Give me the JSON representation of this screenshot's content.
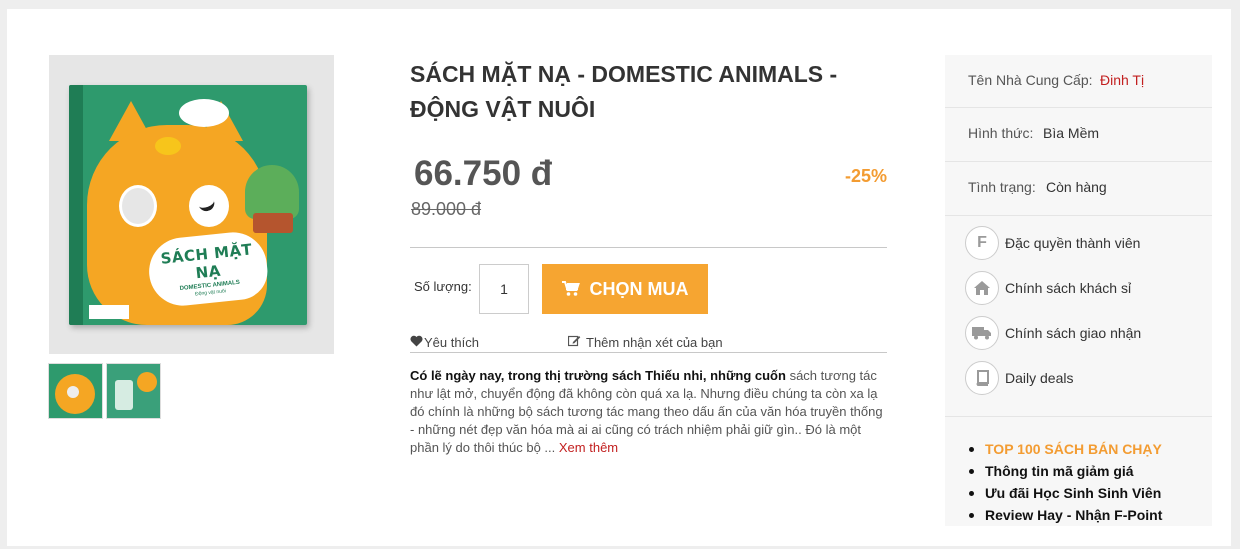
{
  "product": {
    "title": "SÁCH MẶT NẠ - DOMESTIC ANIMALS - ĐỘNG VẬT NUÔI",
    "price": "66.750 đ",
    "old_price": "89.000 đ",
    "discount": "-25%",
    "cover_title": "SÁCH MẶT NẠ",
    "cover_subtitle": "DOMESTIC ANIMALS",
    "cover_subtitle2": "Động vật nuôi"
  },
  "purchase": {
    "qty_label": "Số lượng:",
    "qty_value": "1",
    "buy_label": "CHỌN MUA"
  },
  "actions": {
    "like_label": "Yêu thích",
    "review_label": "Thêm nhận xét của bạn"
  },
  "description": {
    "bold_intro": "Có lẽ ngày nay, trong thị trường sách Thiếu nhi, những cuốn",
    "text": " sách tương tác như lật mở, chuyển động đã không còn quá xa lạ. Nhưng điều chúng ta còn xa lạ đó chính là những bộ sách tương tác mang theo dấu ấn của văn hóa truyền thống - những nét đẹp văn hóa mà ai ai cũng có trách nhiệm phải giữ gìn.. Đó là một phần lý do thôi thúc bộ ... ",
    "more": "Xem thêm"
  },
  "sidebar": {
    "supplier_label": "Tên Nhà Cung Cấp:",
    "supplier_value": "Đinh Tị",
    "format_label": "Hình thức:",
    "format_value": "Bìa Mềm",
    "status_label": "Tình trạng:",
    "status_value": "Còn hàng",
    "perks": [
      {
        "label": "Đặc quyền thành viên",
        "icon": "F"
      },
      {
        "label": "Chính sách khách sỉ",
        "icon": "home-icon"
      },
      {
        "label": "Chính sách giao nhận",
        "icon": "truck-icon"
      },
      {
        "label": "Daily deals",
        "icon": "book-icon"
      }
    ],
    "links": [
      "TOP 100 SÁCH BÁN CHẠY",
      "Thông tin mã giảm giá",
      "Ưu đãi Học Sinh Sinh Viên",
      "Review Hay - Nhận F-Point"
    ]
  },
  "colors": {
    "accent": "#f6a531",
    "discount": "#f39c32",
    "supplier": "#c21f1f"
  }
}
